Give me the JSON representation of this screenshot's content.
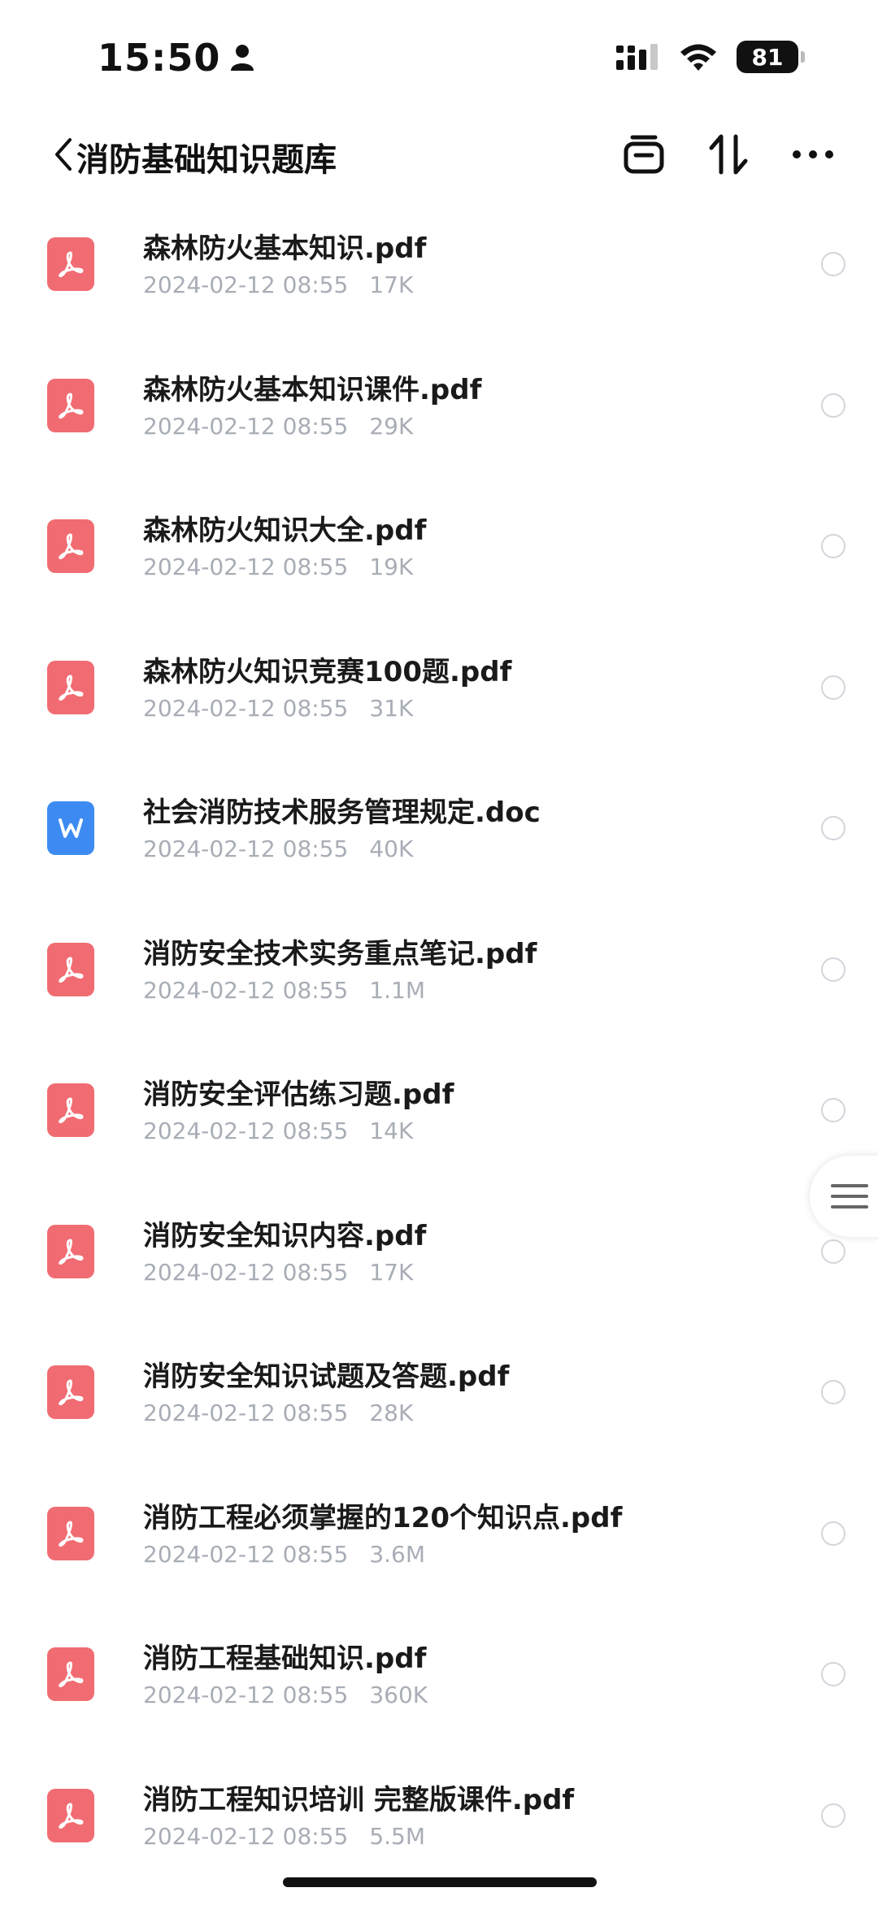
{
  "status_bar": {
    "time": "15:50",
    "battery": "81",
    "icons": [
      "person-icon",
      "signal-icon",
      "wifi-icon",
      "battery-icon"
    ]
  },
  "header": {
    "title": "消防基础知识题库",
    "icons": [
      "back-icon",
      "archive-icon",
      "sort-icon",
      "more-icon"
    ]
  },
  "files": [
    {
      "name": "森林防火基本知识.pdf",
      "date": "2024-02-12 08:55",
      "size": "17K",
      "type": "pdf"
    },
    {
      "name": "森林防火基本知识课件.pdf",
      "date": "2024-02-12 08:55",
      "size": "29K",
      "type": "pdf"
    },
    {
      "name": "森林防火知识大全.pdf",
      "date": "2024-02-12 08:55",
      "size": "19K",
      "type": "pdf"
    },
    {
      "name": "森林防火知识竞赛100题.pdf",
      "date": "2024-02-12 08:55",
      "size": "31K",
      "type": "pdf"
    },
    {
      "name": "社会消防技术服务管理规定.doc",
      "date": "2024-02-12 08:55",
      "size": "40K",
      "type": "doc"
    },
    {
      "name": "消防安全技术实务重点笔记.pdf",
      "date": "2024-02-12 08:55",
      "size": "1.1M",
      "type": "pdf"
    },
    {
      "name": "消防安全评估练习题.pdf",
      "date": "2024-02-12 08:55",
      "size": "14K",
      "type": "pdf"
    },
    {
      "name": "消防安全知识内容.pdf",
      "date": "2024-02-12 08:55",
      "size": "17K",
      "type": "pdf"
    },
    {
      "name": "消防安全知识试题及答题.pdf",
      "date": "2024-02-12 08:55",
      "size": "28K",
      "type": "pdf"
    },
    {
      "name": "消防工程必须掌握的120个知识点.pdf",
      "date": "2024-02-12 08:55",
      "size": "3.6M",
      "type": "pdf"
    },
    {
      "name": "消防工程基础知识.pdf",
      "date": "2024-02-12 08:55",
      "size": "360K",
      "type": "pdf"
    },
    {
      "name": "消防工程知识培训 完整版课件.pdf",
      "date": "2024-02-12 08:55",
      "size": "5.5M",
      "type": "pdf"
    }
  ],
  "colors": {
    "pdf_icon": "#f06c72",
    "doc_icon": "#3d8bf2",
    "meta_text": "#a8adb6"
  }
}
